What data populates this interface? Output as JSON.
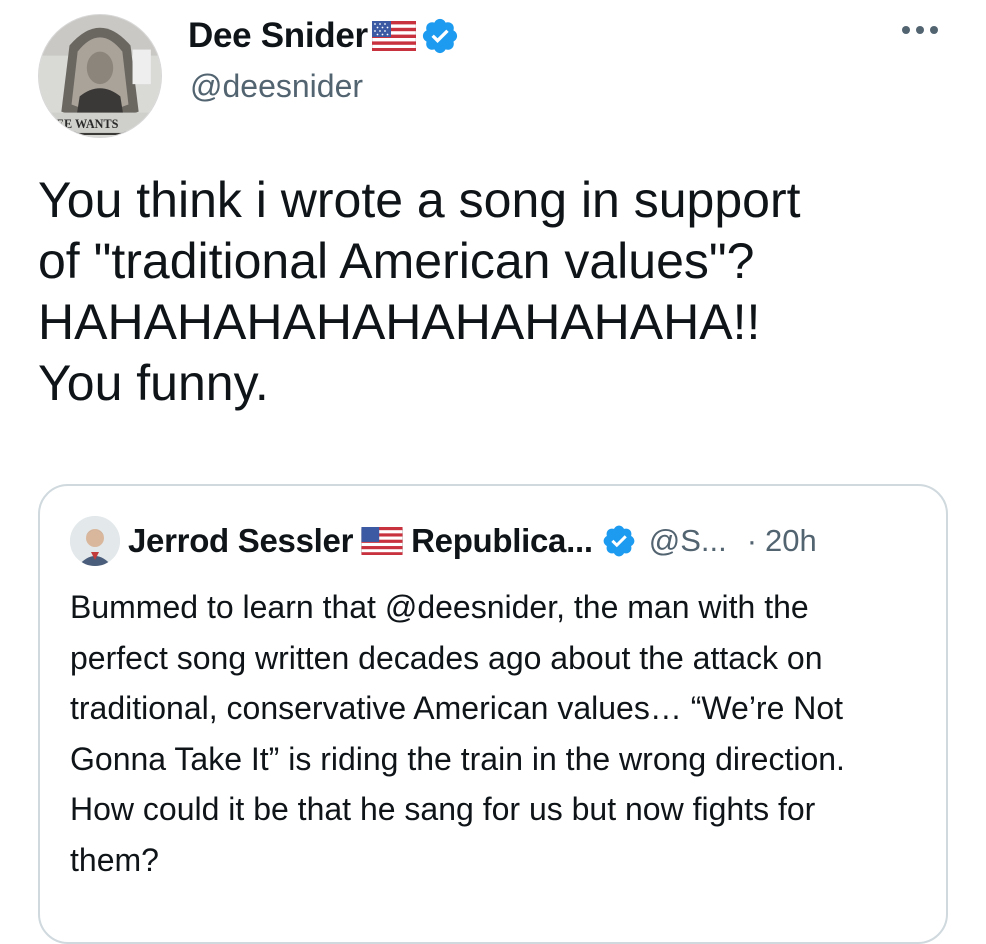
{
  "author": {
    "display_name": "Dee Snider",
    "handle": "@deesnider",
    "flag_icon": "us-flag-icon",
    "verified_icon": "verified-badge-icon",
    "avatar_text": "DEE WANTS"
  },
  "menu": {
    "icon": "more-icon"
  },
  "tweet": {
    "text": "You think i wrote a song in support\nof \"traditional American values\"?\nHAHAHAHAHAHAHAHAHAHA!!\nYou funny."
  },
  "quote": {
    "display_name": "Jerrod Sessler",
    "name_suffix": "Republica...",
    "handle": "@S...",
    "separator": "·",
    "time": "20h",
    "text": "Bummed to learn that @deesnider, the man with the perfect song written decades ago about the attack on traditional, conservative American values… “We’re Not Gonna Take It” is riding the train in the wrong direction. How could it be that he sang for us but now fights for them?"
  },
  "colors": {
    "text": "#0f1419",
    "secondary": "#536471",
    "verified": "#1d9bf0",
    "border": "#cfd9de"
  }
}
